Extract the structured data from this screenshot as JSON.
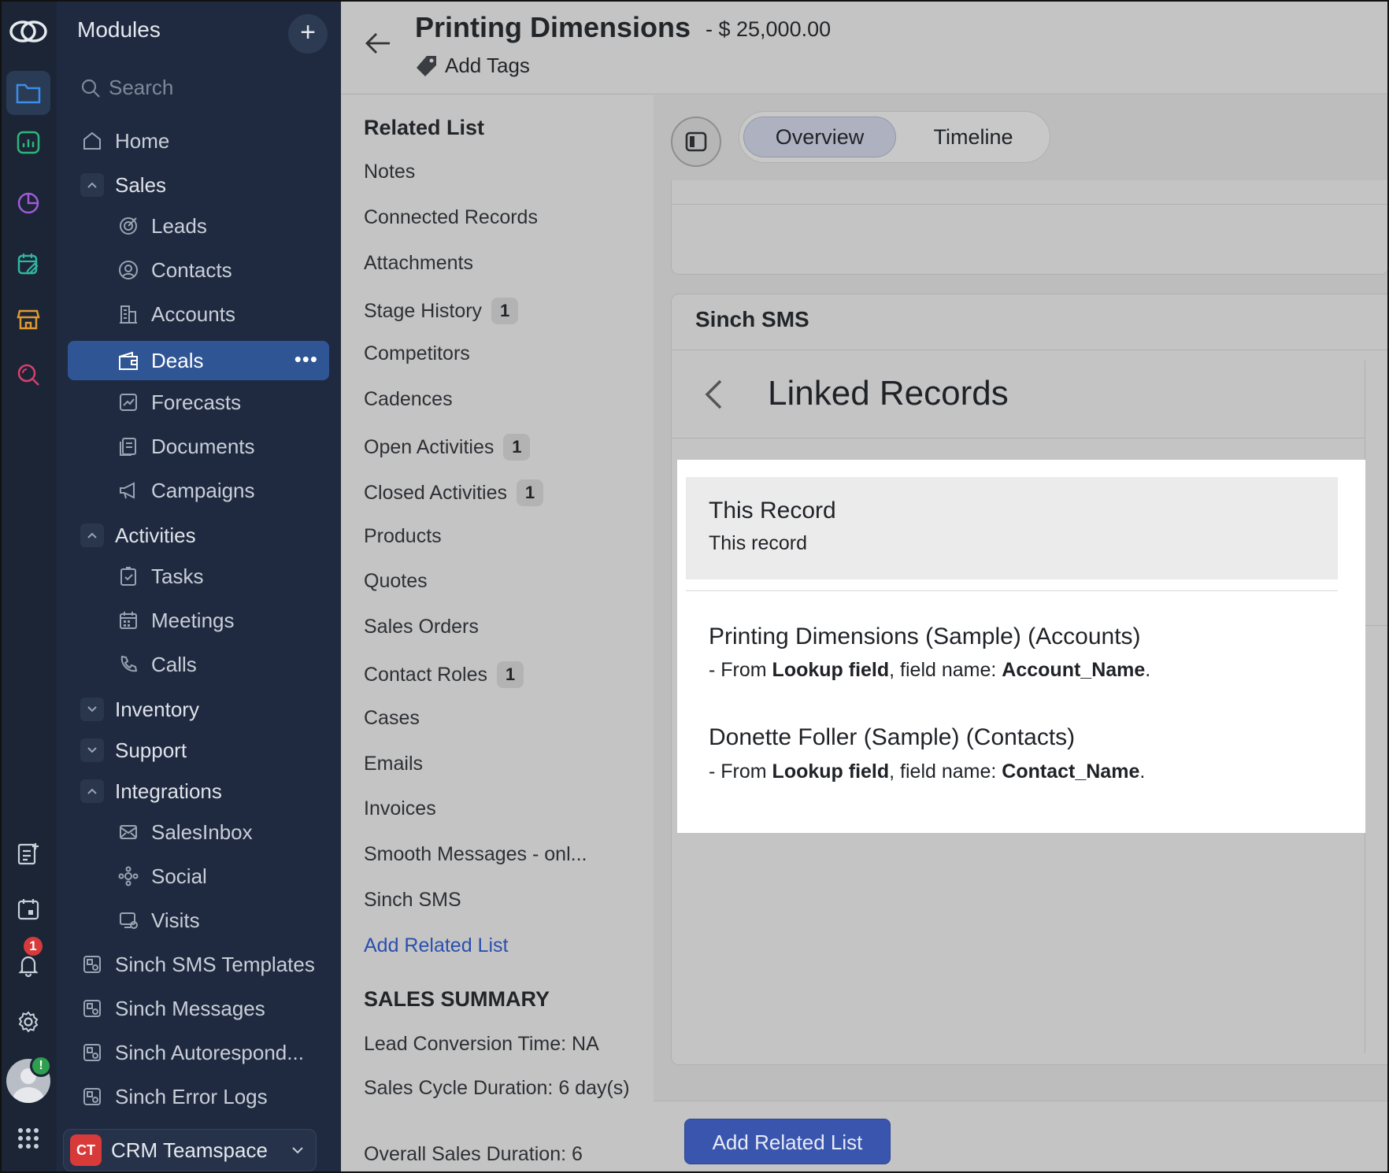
{
  "sidebar": {
    "title": "Modules",
    "plus": "+",
    "search_placeholder": "Search",
    "items": {
      "home": "Home",
      "sales": "Sales",
      "leads": "Leads",
      "contacts": "Contacts",
      "accounts": "Accounts",
      "deals": "Deals",
      "forecasts": "Forecasts",
      "documents": "Documents",
      "campaigns": "Campaigns",
      "activities": "Activities",
      "tasks": "Tasks",
      "meetings": "Meetings",
      "calls": "Calls",
      "inventory": "Inventory",
      "support": "Support",
      "integrations": "Integrations",
      "salesinbox": "SalesInbox",
      "social": "Social",
      "visits": "Visits",
      "sinch_sms_templates": "Sinch SMS Templates",
      "sinch_messages": "Sinch Messages",
      "sinch_autorespond": "Sinch Autorespond...",
      "sinch_error_logs": "Sinch Error Logs"
    },
    "deals_more": "•••",
    "teamspace": {
      "badge": "CT",
      "label": "CRM Teamspace"
    }
  },
  "rail": {
    "notification_count": "1",
    "avatar_badge": "!"
  },
  "header": {
    "title": "Printing Dimensions",
    "amount": "- $ 25,000.00",
    "add_tags": "Add Tags"
  },
  "related_list": {
    "heading": "Related List",
    "items": [
      {
        "label": "Notes",
        "count": ""
      },
      {
        "label": "Connected Records",
        "count": ""
      },
      {
        "label": "Attachments",
        "count": ""
      },
      {
        "label": "Stage History",
        "count": "1"
      },
      {
        "label": "Competitors",
        "count": ""
      },
      {
        "label": "Cadences",
        "count": ""
      },
      {
        "label": "Open Activities",
        "count": "1"
      },
      {
        "label": "Closed Activities",
        "count": "1"
      },
      {
        "label": "Products",
        "count": ""
      },
      {
        "label": "Quotes",
        "count": ""
      },
      {
        "label": "Sales Orders",
        "count": ""
      },
      {
        "label": "Contact Roles",
        "count": "1"
      },
      {
        "label": "Cases",
        "count": ""
      },
      {
        "label": "Emails",
        "count": ""
      },
      {
        "label": "Invoices",
        "count": ""
      },
      {
        "label": "Smooth Messages - onl...",
        "count": ""
      },
      {
        "label": "Sinch SMS",
        "count": ""
      }
    ],
    "add_link": "Add Related List",
    "summary_heading": "SALES SUMMARY",
    "summary": {
      "lead_conversion": "Lead Conversion Time: NA",
      "sales_cycle": "Sales Cycle Duration: 6 day(s)",
      "overall": "Overall Sales Duration: 6"
    }
  },
  "tabs": {
    "overview": "Overview",
    "timeline": "Timeline",
    "active": "Overview"
  },
  "sinch_sms": {
    "title": "Sinch SMS",
    "linked_records_title": "Linked Records",
    "this_record": {
      "title": "This Record",
      "subtitle": "This record"
    },
    "records": [
      {
        "title": "Printing Dimensions (Sample) (Accounts)",
        "prefix": "- From ",
        "source": "Lookup field",
        "mid": ", field name: ",
        "field": "Account_Name",
        "suffix": "."
      },
      {
        "title": "Donette Foller (Sample) (Contacts)",
        "prefix": "- From ",
        "source": "Lookup field",
        "mid": ", field name: ",
        "field": "Contact_Name",
        "suffix": "."
      }
    ]
  },
  "bottom": {
    "add_related_button": "Add Related List"
  },
  "colors": {
    "rail_bg": "#1b2535",
    "sidebar_bg": "#1f2a40",
    "active_item": "#2f5594",
    "primary_button": "#3a55ae",
    "link": "#2a4fae",
    "notification": "#d63b3b"
  }
}
